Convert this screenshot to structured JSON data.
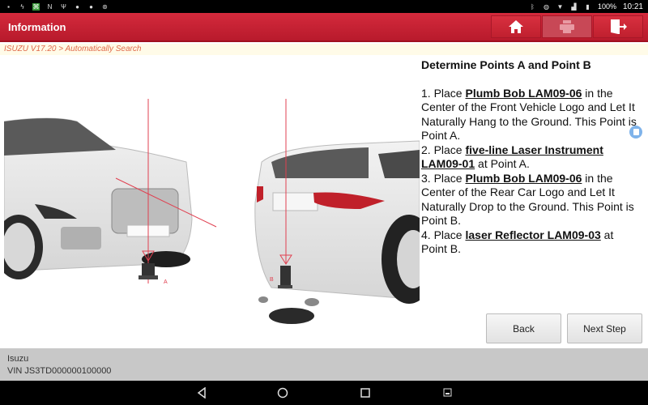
{
  "status_bar": {
    "left_icons": [
      "gallery-icon",
      "usb-debug-icon",
      "app-icon",
      "n-icon",
      "usb-icon",
      "shield-icon",
      "shield-icon",
      "accessibility-icon"
    ],
    "right_icons": [
      "bluetooth-icon",
      "vibrate-icon",
      "wifi-icon",
      "signal-icon",
      "battery-icon"
    ],
    "battery": "100%",
    "time": "10:21"
  },
  "header": {
    "title": "Information",
    "buttons": [
      {
        "name": "home",
        "icon": "home-icon",
        "enabled": true
      },
      {
        "name": "print",
        "icon": "printer-icon",
        "enabled": false
      },
      {
        "name": "exit",
        "icon": "exit-icon",
        "enabled": true
      }
    ]
  },
  "breadcrumb": "ISUZU V17.20 > Automatically Search",
  "illustration": {
    "label_a": "A",
    "label_b": "B"
  },
  "instructions": {
    "title": "Determine Points A and Point B",
    "steps": [
      {
        "prefix": "1. Place ",
        "tool": "Plumb Bob LAM09-06",
        "suffix": " in the Center of the Front Vehicle Logo and Let It Naturally Hang to the Ground. This Point is Point A."
      },
      {
        "prefix": "2. Place ",
        "tool": "five-line Laser Instrument LAM09-01",
        "suffix": " at Point A."
      },
      {
        "prefix": "3. Place ",
        "tool": "Plumb Bob LAM09-06",
        "suffix": " in the Center of the Rear Car Logo and Let It Naturally Drop to the Ground. This Point is Point B."
      },
      {
        "prefix": "4. Place ",
        "tool": "laser Reflector LAM09-03",
        "suffix": " at Point B."
      }
    ]
  },
  "buttons": {
    "back": "Back",
    "next": "Next Step"
  },
  "footer": {
    "make": "Isuzu",
    "vin": "VIN JS3TD000000100000"
  },
  "nav": [
    "back-icon",
    "home-circle-icon",
    "recents-icon",
    "screenshot-icon"
  ]
}
